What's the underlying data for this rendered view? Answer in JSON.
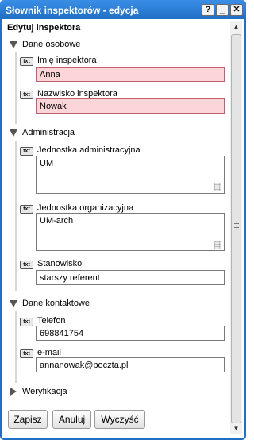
{
  "window": {
    "title": "Słownik inspektorów - edycja"
  },
  "titlebar_buttons": {
    "help": "?",
    "minimize": "_",
    "close": "✕"
  },
  "form": {
    "subheading": "Edytuj inspektora"
  },
  "badge_text": "txt",
  "sections": {
    "personal": {
      "label": "Dane osobowe",
      "first_name": {
        "label": "Imię inspektora",
        "value": "Anna"
      },
      "last_name": {
        "label": "Nazwisko inspektora",
        "value": "Nowak"
      }
    },
    "admin": {
      "label": "Administracja",
      "admin_unit": {
        "label": "Jednostka administracyjna",
        "value": "UM"
      },
      "org_unit": {
        "label": "Jednostka organizacyjna",
        "value": "UM-arch"
      },
      "position": {
        "label": "Stanowisko",
        "value": "starszy referent"
      }
    },
    "contact": {
      "label": "Dane kontaktowe",
      "phone": {
        "label": "Telefon",
        "value": "698841754"
      },
      "email": {
        "label": "e-mail",
        "value": "annanowak@poczta.pl"
      }
    },
    "verification": {
      "label": "Weryfikacja"
    }
  },
  "buttons": {
    "save": "Zapisz",
    "cancel": "Anuluj",
    "clear": "Wyczyść"
  },
  "colors": {
    "titlebar": "#1f6fc4",
    "invalid_field": "#fbd5d7"
  }
}
